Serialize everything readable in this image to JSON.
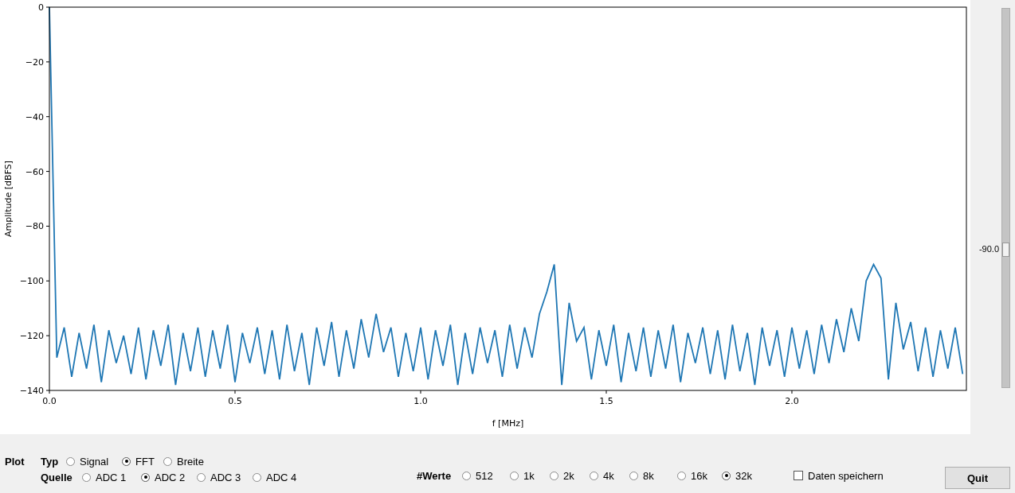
{
  "plot": {
    "chart_data": {
      "type": "line",
      "xlabel": "f [MHz]",
      "ylabel": "Amplitude [dBFS]",
      "xlim": [
        0,
        2.47
      ],
      "ylim": [
        -140,
        0
      ],
      "xticks": [
        {
          "value": 0,
          "label": "0.0"
        },
        {
          "value": 0.5,
          "label": "0.5"
        },
        {
          "value": 1,
          "label": "1.0"
        },
        {
          "value": 1.5,
          "label": "1.5"
        },
        {
          "value": 2,
          "label": "2.0"
        }
      ],
      "yticks": [
        {
          "value": 0,
          "label": "0"
        },
        {
          "value": -20,
          "label": "−20"
        },
        {
          "value": -40,
          "label": "−40"
        },
        {
          "value": -60,
          "label": "−60"
        },
        {
          "value": -80,
          "label": "−80"
        },
        {
          "value": -100,
          "label": "−100"
        },
        {
          "value": -120,
          "label": "−120"
        },
        {
          "value": -140,
          "label": "−140"
        }
      ],
      "x": [
        0,
        0.02,
        0.04,
        0.06,
        0.08,
        0.1,
        0.12,
        0.14,
        0.16,
        0.18,
        0.2,
        0.22,
        0.24,
        0.26,
        0.28,
        0.3,
        0.32,
        0.34,
        0.36,
        0.38,
        0.4,
        0.42,
        0.44,
        0.46,
        0.48,
        0.5,
        0.52,
        0.54,
        0.56,
        0.58,
        0.6,
        0.62,
        0.64,
        0.66,
        0.68,
        0.7,
        0.72,
        0.74,
        0.76,
        0.78,
        0.8,
        0.82,
        0.84,
        0.86,
        0.88,
        0.9,
        0.92,
        0.94,
        0.96,
        0.98,
        1,
        1.02,
        1.04,
        1.06,
        1.08,
        1.1,
        1.12,
        1.14,
        1.16,
        1.18,
        1.2,
        1.22,
        1.24,
        1.26,
        1.28,
        1.3,
        1.32,
        1.34,
        1.36,
        1.38,
        1.4,
        1.42,
        1.44,
        1.46,
        1.48,
        1.5,
        1.52,
        1.54,
        1.56,
        1.58,
        1.6,
        1.62,
        1.64,
        1.66,
        1.68,
        1.7,
        1.72,
        1.74,
        1.76,
        1.78,
        1.8,
        1.82,
        1.84,
        1.86,
        1.88,
        1.9,
        1.92,
        1.94,
        1.96,
        1.98,
        2,
        2.02,
        2.04,
        2.06,
        2.08,
        2.1,
        2.12,
        2.14,
        2.16,
        2.18,
        2.2,
        2.22,
        2.24,
        2.26,
        2.28,
        2.3,
        2.32,
        2.34,
        2.36,
        2.38,
        2.4,
        2.42,
        2.44,
        2.46
      ],
      "series": [
        {
          "color": "#1f77b4",
          "values": [
            0,
            -128,
            -117,
            -135,
            -119,
            -132,
            -116,
            -137,
            -118,
            -130,
            -120,
            -134,
            -117,
            -136,
            -118,
            -131,
            -116,
            -138,
            -119,
            -133,
            -117,
            -135,
            -118,
            -132,
            -116,
            -137,
            -119,
            -130,
            -117,
            -134,
            -118,
            -136,
            -116,
            -133,
            -119,
            -138,
            -117,
            -131,
            -115,
            -135,
            -118,
            -132,
            -114,
            -128,
            -112,
            -126,
            -117,
            -135,
            -119,
            -133,
            -117,
            -136,
            -118,
            -131,
            -116,
            -138,
            -119,
            -134,
            -117,
            -130,
            -118,
            -135,
            -116,
            -132,
            -117,
            -128,
            -112,
            -104,
            -94,
            -138,
            -108,
            -122,
            -117,
            -136,
            -118,
            -131,
            -116,
            -137,
            -119,
            -133,
            -117,
            -135,
            -118,
            -132,
            -116,
            -137,
            -119,
            -130,
            -117,
            -134,
            -118,
            -136,
            -116,
            -133,
            -119,
            -138,
            -117,
            -131,
            -118,
            -135,
            -117,
            -132,
            -118,
            -134,
            -116,
            -130,
            -114,
            -126,
            -110,
            -122,
            -100,
            -94,
            -99,
            -136,
            -108,
            -125,
            -115,
            -133,
            -117,
            -135,
            -118,
            -132,
            -117,
            -134
          ]
        }
      ]
    }
  },
  "slider": {
    "level": 0.36,
    "reading": "-90.0"
  },
  "controls": {
    "title": "Plot",
    "typ": {
      "label": "Typ",
      "options": [
        {
          "label": "Signal",
          "selected": false
        },
        {
          "label": "FFT",
          "selected": true
        },
        {
          "label": "Breite",
          "selected": false
        }
      ]
    },
    "quelle": {
      "label": "Quelle",
      "options": [
        {
          "label": "ADC 1",
          "selected": false
        },
        {
          "label": "ADC 2",
          "selected": true
        },
        {
          "label": "ADC 3",
          "selected": false
        },
        {
          "label": "ADC 4",
          "selected": false
        }
      ]
    },
    "werte": {
      "label": "#Werte",
      "options": [
        {
          "label": "512",
          "selected": false
        },
        {
          "label": "1k",
          "selected": false
        },
        {
          "label": "2k",
          "selected": false
        },
        {
          "label": "4k",
          "selected": false
        },
        {
          "label": "8k",
          "selected": false
        },
        {
          "label": "16k",
          "selected": false
        },
        {
          "label": "32k",
          "selected": true
        }
      ]
    },
    "save": {
      "label": "Daten speichern",
      "checked": false
    },
    "quit": "Quit"
  }
}
